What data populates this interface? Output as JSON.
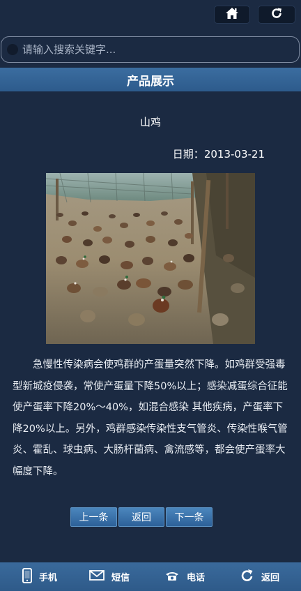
{
  "search": {
    "placeholder": "请输入搜索关键字..."
  },
  "section": {
    "title": "产品展示"
  },
  "product": {
    "name": "山鸡",
    "date_label": "日期：",
    "date": "2013-03-21",
    "description": "急慢性传染病会使鸡群的产蛋量突然下降。如鸡群受强毒型新城疫侵袭，常使产蛋量下降50%以上；感染减蛋综合征能使产蛋率下降20%～40%，如混合感染 其他疾病，产蛋率下降20%以上。另外，鸡群感染传染性支气管炎、传染性喉气管炎、霍乱、球虫病、大肠杆菌病、禽流感等，都会使产蛋率大幅度下降。"
  },
  "pager": {
    "prev": "上一条",
    "back": "返回",
    "next": "下一条"
  },
  "bottom_nav": {
    "phone": "手机",
    "sms": "短信",
    "call": "电话",
    "back": "返回"
  },
  "icons": {
    "home": "home-icon",
    "refresh": "refresh-icon",
    "phone": "mobile-phone-icon",
    "sms": "envelope-icon",
    "call": "telephone-icon",
    "back": "back-arrow-icon"
  },
  "colors": {
    "background": "#1b2a42",
    "section_bar": "#33649a",
    "button": "#3c75ad"
  }
}
